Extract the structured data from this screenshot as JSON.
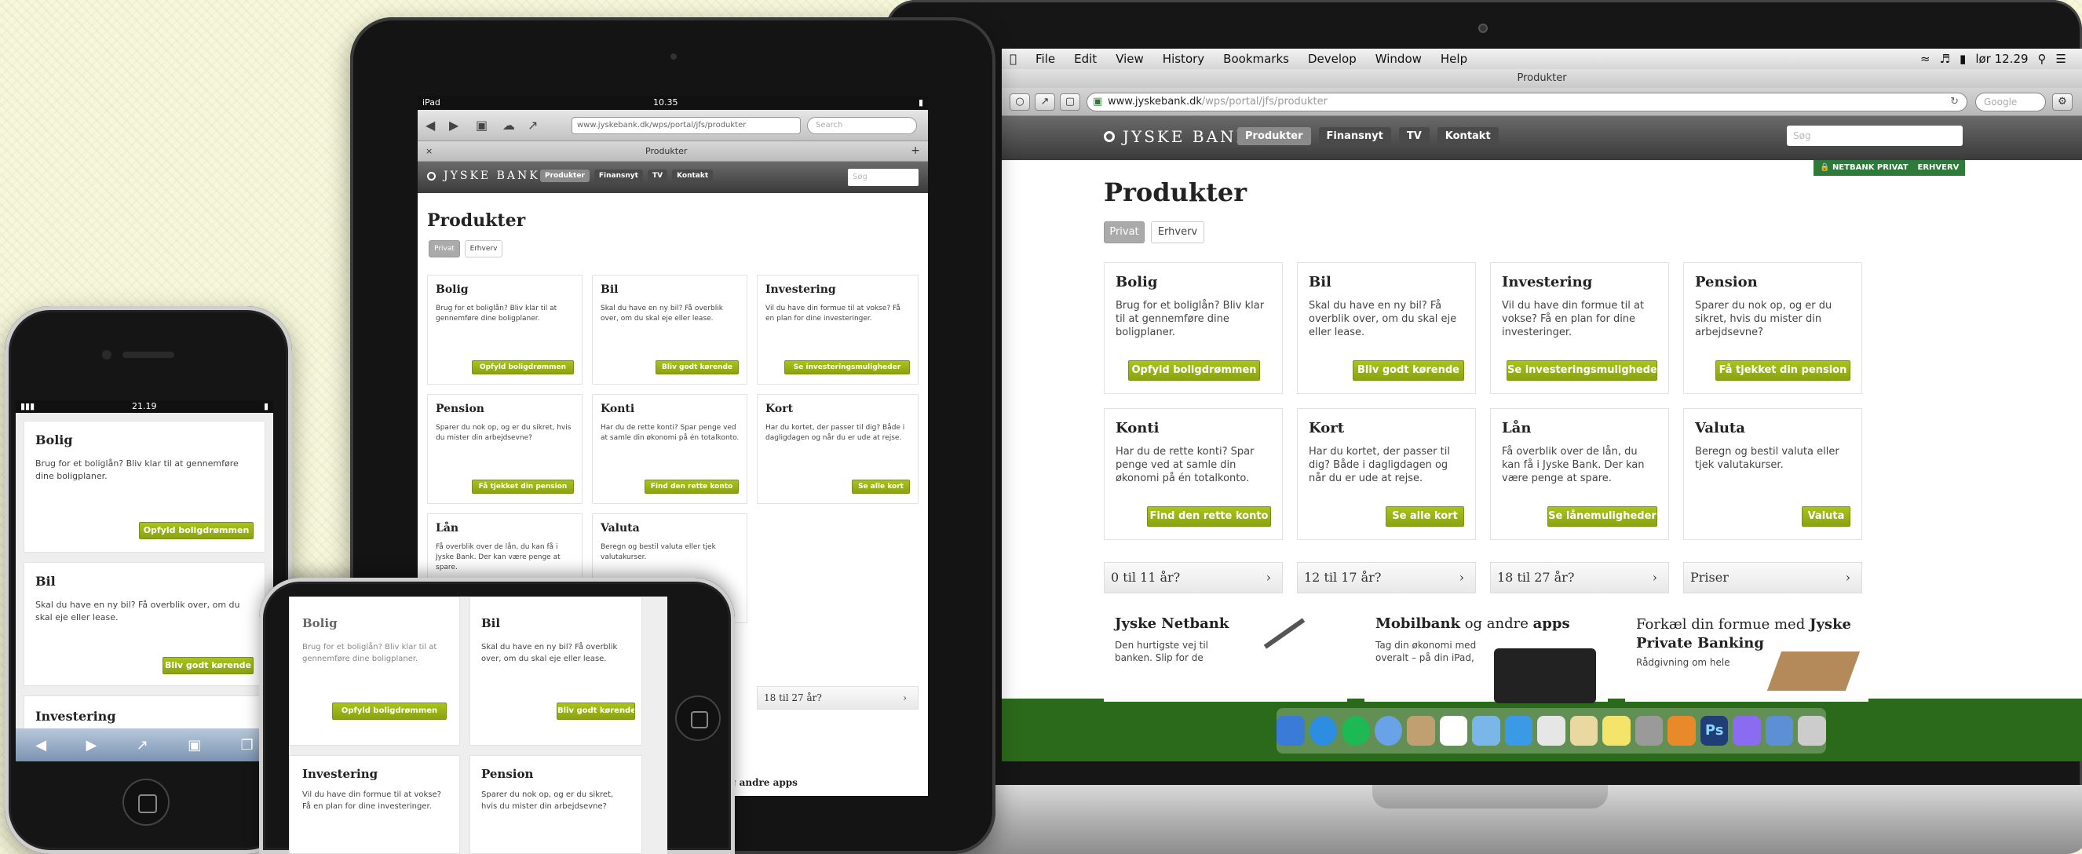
{
  "site": {
    "brand": "JYSKE BANK",
    "nav": [
      "Produkter",
      "Finansnyt",
      "TV",
      "Kontakt"
    ],
    "search_placeholder": "Søg",
    "netbank": "NETBANK PRIVAT",
    "erhverv_link": "ERHVERV",
    "page_title": "Produkter",
    "segment_tabs": [
      "Privat",
      "Erhverv"
    ],
    "products": [
      {
        "title": "Bolig",
        "text": "Brug for et boliglån? Bliv klar til at gennemføre dine boligplaner.",
        "button": "Opfyld boligdrømmen"
      },
      {
        "title": "Bil",
        "text": "Skal du have en ny bil? Få overblik over, om du skal eje eller lease.",
        "button": "Bliv godt kørende"
      },
      {
        "title": "Investering",
        "text": "Vil du have din formue til at vokse? Få en plan for dine investeringer.",
        "button": "Se investeringsmuligheder"
      },
      {
        "title": "Pension",
        "text": "Sparer du nok op, og er du sikret, hvis du mister din arbejdsevne?",
        "button": "Få tjekket din pension"
      },
      {
        "title": "Konti",
        "text": "Har du de rette konti? Spar penge ved at samle din økonomi på én totalkonto.",
        "button": "Find den rette konto"
      },
      {
        "title": "Kort",
        "text": "Har du kortet, der passer til dig? Både i dagligdagen og når du er ude at rejse.",
        "button": "Se alle kort"
      },
      {
        "title": "Lån",
        "text": "Få overblik over de lån, du kan få i Jyske Bank. Der kan være penge at spare.",
        "button": "Se lånemuligheder"
      },
      {
        "title": "Valuta",
        "text": "Beregn og bestil valuta eller tjek valutakurser.",
        "button": "Valuta"
      }
    ],
    "age_rows": [
      "0 til 11 år?",
      "12 til 17 år?",
      "18 til 27 år?",
      "Priser"
    ],
    "promos": [
      {
        "title": "Jyske Netbank",
        "text": "Den hurtigste vej til banken. Slip for de"
      },
      {
        "title_a": "Mobilbank",
        "title_b": " og andre ",
        "title_c": "apps",
        "text": "Tag din økonomi med overalt – på din iPad,"
      },
      {
        "title_a": "Forkæl din formue med ",
        "title_b": "Jyske Private Banking",
        "text": "Rådgivning om hele"
      }
    ],
    "partial_promo": "ank og andre apps"
  },
  "desktop": {
    "menubar": [
      "File",
      "Edit",
      "View",
      "History",
      "Bookmarks",
      "Develop",
      "Window",
      "Help"
    ],
    "clock": "lør 12.29",
    "window_title": "Produkter",
    "url_host": "www.jyskebank.dk",
    "url_path": "/wps/portal/jfs/produkter",
    "search_field": "Google"
  },
  "tablet": {
    "carrier": "iPad",
    "time": "10.35",
    "url": "www.jyskebank.dk/wps/portal/jfs/produkter",
    "search_field": "Search",
    "tab_title": "Produkter"
  },
  "phone": {
    "time": "21.19"
  },
  "colors": {
    "accent_green": "#9ab51a",
    "header_dark": "#4a4a4a",
    "netbank_green": "#2f7a3a"
  }
}
